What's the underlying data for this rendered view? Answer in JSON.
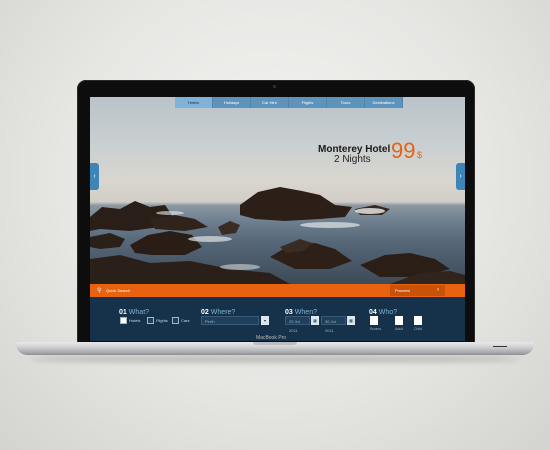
{
  "nav": {
    "tabs": [
      "Hotels",
      "Holidays",
      "Car Hire",
      "Flights",
      "Tours",
      "Destinations"
    ],
    "active_index": 0
  },
  "promo": {
    "hotel": "Monterey Hotel",
    "nights": "2 Nights",
    "price": "99",
    "currency": "$"
  },
  "search_bar": {
    "label": "Quick Search",
    "proceed": "Proceed"
  },
  "steps": {
    "what": {
      "num": "01",
      "label": "What?",
      "options": [
        "Hotels",
        "Flights",
        "Cars"
      ]
    },
    "where": {
      "num": "02",
      "label": "Where?",
      "value": "Perth"
    },
    "when": {
      "num": "03",
      "label": "When?",
      "from": "20 Jul 2011",
      "to": "30 Jul 2011"
    },
    "who": {
      "num": "04",
      "label": "Who?",
      "rooms_label": "Rooms",
      "adult_label": "Adult",
      "child_label": "Child"
    }
  },
  "laptop": {
    "brand": "MacBook Pro"
  },
  "colors": {
    "accent": "#e8620f",
    "nav_blue": "#5e94bc",
    "panel": "#16324a"
  }
}
